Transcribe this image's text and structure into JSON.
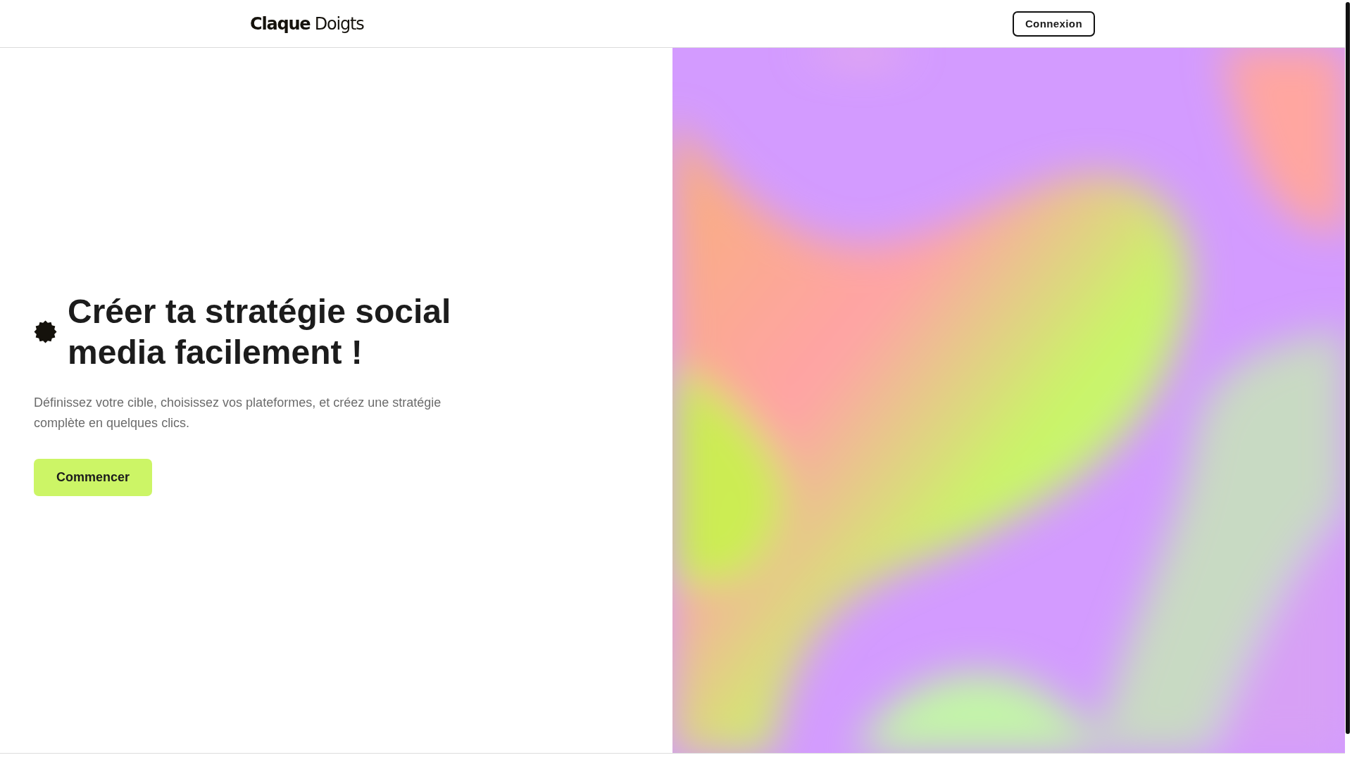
{
  "header": {
    "logo": "**Claque** Doigts",
    "login_button": "Connexion"
  },
  "hero": {
    "title": "Créer ta stratégie social media facilement !",
    "description": "Définissez votre cible, choisissez vos plateformes, et créez une stratégie complète en quelques clics.",
    "cta_button": "Commencer"
  }
}
